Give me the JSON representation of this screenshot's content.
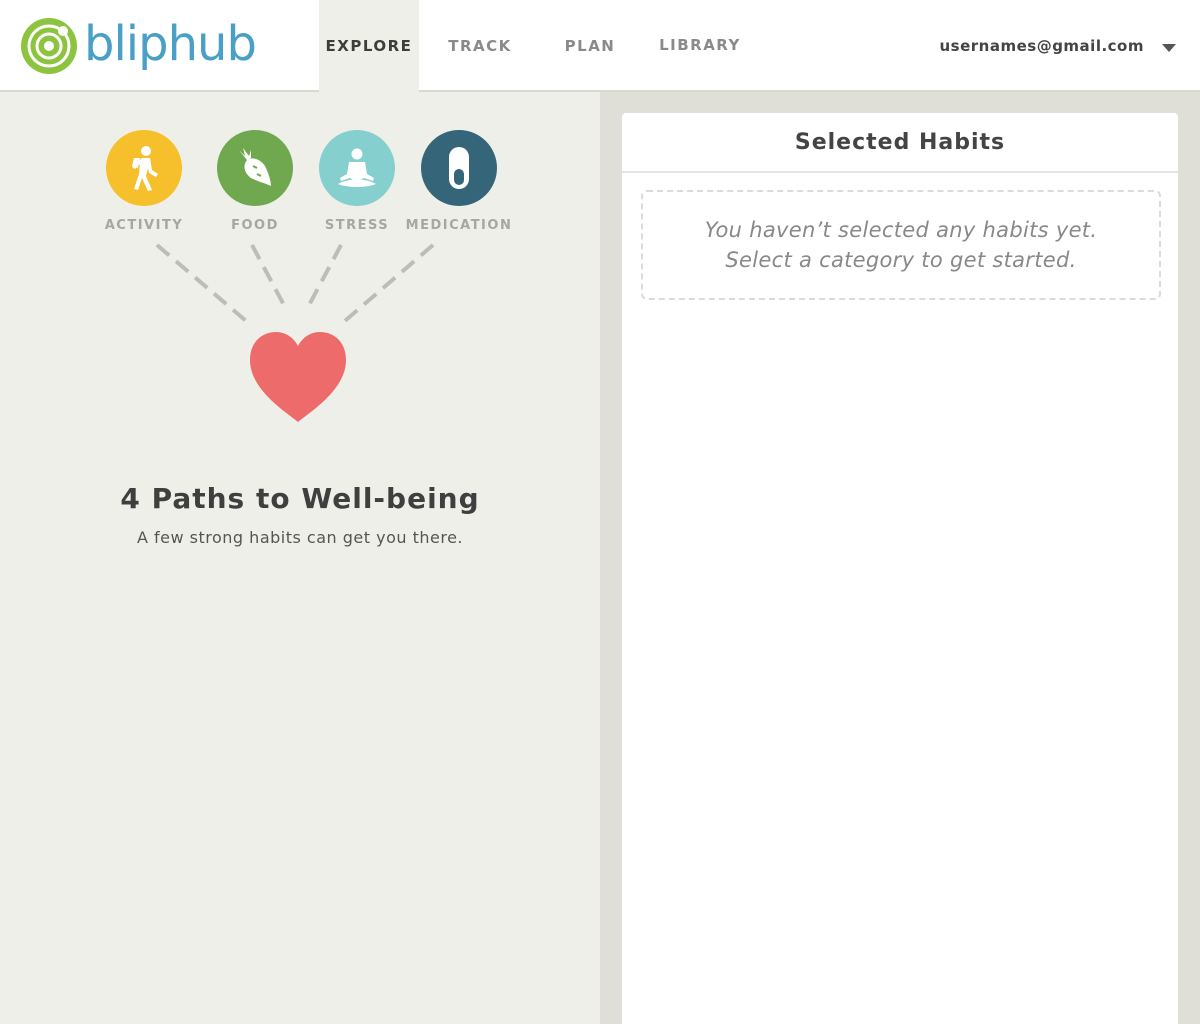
{
  "header": {
    "logo_text": "bliphub",
    "nav": [
      {
        "label": "EXPLORE",
        "active": true
      },
      {
        "label": "TRACK",
        "active": false
      },
      {
        "label": "PLAN",
        "active": false
      },
      {
        "label": "LIBRARY",
        "active": false
      }
    ],
    "account_email": "usernames@gmail.com",
    "account_menu_icon": "chevron-down-icon"
  },
  "explore": {
    "categories": [
      {
        "label": "ACTIVITY",
        "icon": "walking-person-icon",
        "color": "#f5c02b"
      },
      {
        "label": "FOOD",
        "icon": "carrot-icon",
        "color": "#6fa84e"
      },
      {
        "label": "STRESS",
        "icon": "meditation-icon",
        "color": "#86cfcf"
      },
      {
        "label": "MEDICATION",
        "icon": "pill-icon",
        "color": "#356578"
      }
    ],
    "heart_icon": "heart-icon",
    "heart_color": "#ee6b6b",
    "headline": "4 Paths to Well-being",
    "subline": "A few strong habits can get you there."
  },
  "selected": {
    "title": "Selected Habits",
    "empty_line1": "You haven’t selected any habits yet.",
    "empty_line2": "Select a category to get started."
  },
  "colors": {
    "brand_blue": "#4a9fc7",
    "brand_green": "#8dc43f",
    "left_bg": "#efefe9",
    "right_bg": "#dfdfd7"
  }
}
